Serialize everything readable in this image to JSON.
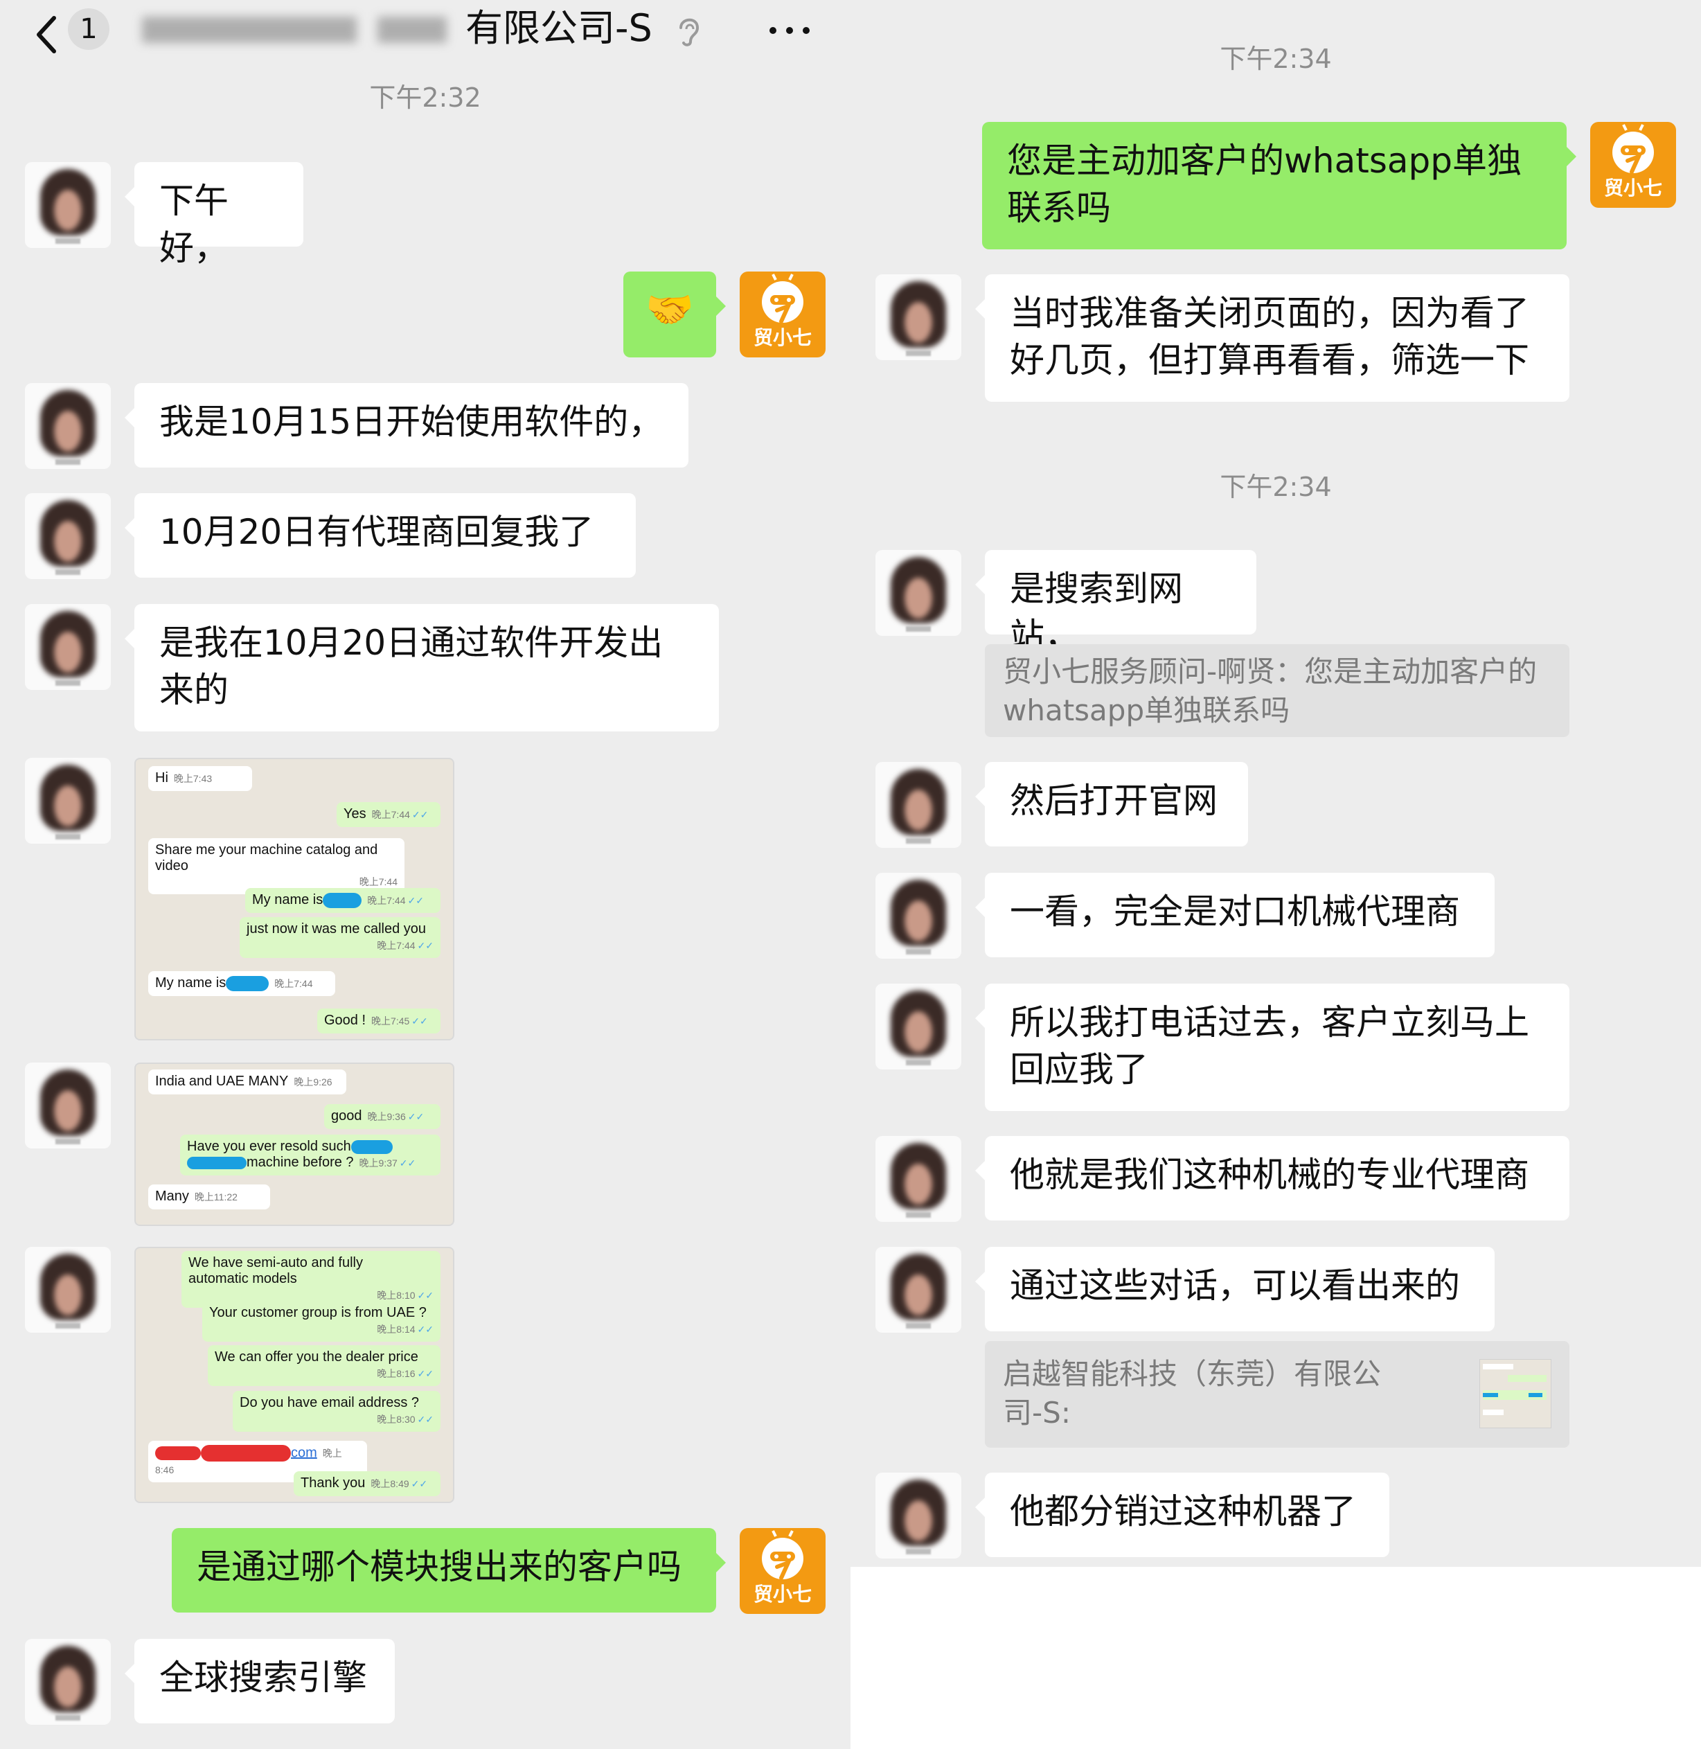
{
  "header": {
    "back_icon": "chevron-left-icon",
    "unread_count": "1",
    "title_suffix": "有限公司-S",
    "ear_icon": "ear-icon",
    "more_icon": "more-dots-icon"
  },
  "colors": {
    "background": "#ededed",
    "my_bubble": "#95ec69",
    "their_bubble": "#ffffff",
    "bot_avatar": "#f39a12",
    "time_text": "#8c8c8c"
  },
  "left": {
    "times": [
      "下午2:32"
    ],
    "messages": [
      "下午好，",
      "🤝",
      "我是10月15日开始使用软件的，",
      "10月20日有代理商回复我了",
      "是我在10月20日通过软件开发出",
      "来的",
      "是通过哪个模块搜出来的客户吗",
      "全球搜索引擎"
    ],
    "bot_label": "贸小七"
  },
  "shot1": [
    {
      "text": "Hi",
      "time": "晚上7:43"
    },
    {
      "text": "Yes",
      "time": "晚上7:44"
    },
    {
      "text": "Share me your machine catalog and",
      "text2": "video",
      "time": "晚上7:44"
    },
    {
      "text": "My name is",
      "time": "晚上7:44"
    },
    {
      "text": "just now it was me called you",
      "time": "晚上7:44"
    },
    {
      "text": "My name is",
      "time": "晚上7:44"
    },
    {
      "text": "Good !",
      "time": "晚上7:45"
    }
  ],
  "shot2": [
    {
      "text": "India and UAE MANY",
      "time": "晚上9:26"
    },
    {
      "text": "good",
      "time": "晚上9:36"
    },
    {
      "text": "Have you ever resold such",
      "text2": "machine before ?",
      "time": "晚上9:37"
    },
    {
      "text": "Many",
      "time": "晚上11:22"
    }
  ],
  "shot3": [
    {
      "text": "We have semi-auto and fully",
      "text2": "automatic models",
      "time": "晚上8:10"
    },
    {
      "text": "Your customer group is from UAE ?",
      "time": "晚上8:14"
    },
    {
      "text": "We can offer you the dealer price",
      "time": "晚上8:16"
    },
    {
      "text": "Do you have email address ?",
      "time": "晚上8:30"
    },
    {
      "text": "com",
      "time": "晚上8:46"
    },
    {
      "text": "Thank you",
      "time": "晚上8:49"
    }
  ],
  "right": {
    "times": [
      "下午2:34",
      "下午2:34"
    ],
    "messages": [
      "您是主动加客户的whatsapp单独",
      "联系吗",
      "当时我准备关闭页面的，因为看了",
      "好几页，但打算再看看，筛选一下",
      "是搜索到网站，",
      "然后打开官网",
      "一看，完全是对口机械代理商",
      "所以我打电话过去，客户立刻马上",
      "回应我了",
      "他就是我们这种机械的专业代理商",
      "通过这些对话，可以看出来的",
      "他都分销过这种机器了"
    ],
    "quotes": [
      "贸小七服务顾问-啊贤：您是主动加客户的",
      "whatsapp单独联系吗",
      "启越智能科技（东莞）有限公",
      "司-S:"
    ],
    "bot_label": "贸小七"
  }
}
